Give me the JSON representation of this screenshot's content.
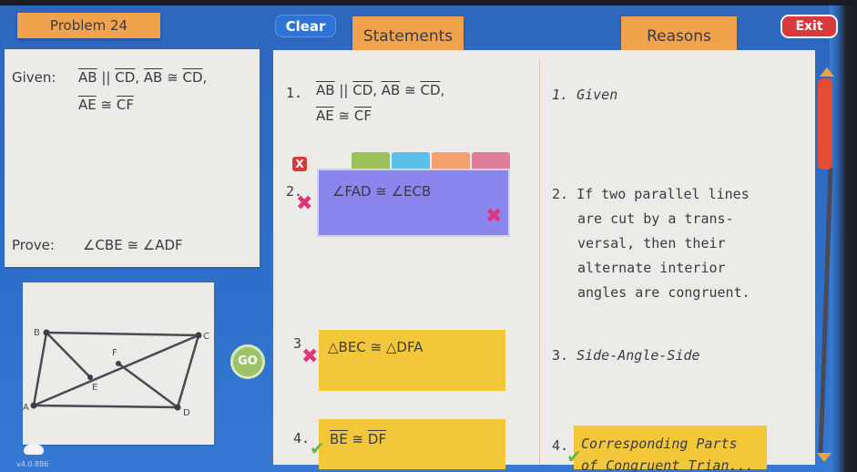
{
  "header": {
    "problem_label": "Problem 24",
    "clear_label": "Clear",
    "statements_label": "Statements",
    "reasons_label": "Reasons",
    "exit_label": "Exit"
  },
  "given": {
    "label": "Given:",
    "line1": {
      "seg1": "AB",
      "parallel": " || ",
      "seg2": "CD",
      "sep": ", ",
      "seg3": "AB",
      "cong": " ≅ ",
      "seg4": "CD",
      "end": ","
    },
    "line2": {
      "seg1": "AE",
      "cong": " ≅ ",
      "seg2": "CF"
    }
  },
  "prove": {
    "label": "Prove:",
    "statement": "∠CBE ≅ ∠ADF"
  },
  "figure": {
    "points": [
      "A",
      "B",
      "C",
      "D",
      "E",
      "F"
    ],
    "segments": [
      "AB",
      "BC",
      "CD",
      "DA",
      "AC",
      "BE",
      "DF"
    ]
  },
  "statements": [
    {
      "number": "1.",
      "line1": {
        "seg1": "AB",
        "parallel": " || ",
        "seg2": "CD",
        "sep": ", ",
        "seg3": "AB",
        "cong": " ≅ ",
        "seg4": "CD",
        "end": ","
      },
      "line2": {
        "seg1": "AE",
        "cong": " ≅ ",
        "seg2": "CF"
      },
      "status": "given"
    },
    {
      "number": "2.",
      "text": "∠FAD ≅ ∠ECB",
      "status": "incorrect",
      "box_color": "#8a86ee"
    },
    {
      "number": "3",
      "text": "△BEC ≅ △DFA",
      "status": "incorrect",
      "box_color": "#f3c73a"
    },
    {
      "number": "4.",
      "seg1": "BE",
      "cong": " ≅ ",
      "seg2": "DF",
      "status": "correct",
      "box_color": "#f3c73a"
    }
  ],
  "reasons": [
    {
      "number": "1.",
      "text": "Given"
    },
    {
      "number": "2.",
      "lines": [
        "If two parallel lines",
        "are cut by a trans-",
        "versal, then their",
        "alternate interior",
        "angles are congruent."
      ]
    },
    {
      "number": "3.",
      "text": "Side-Angle-Side"
    },
    {
      "number": "4.",
      "lines": [
        "Corresponding Parts",
        "of Congruent Trian..."
      ]
    }
  ],
  "color_tabs": [
    "#9cc05a",
    "#5bc0ea",
    "#f5a070",
    "#de7e9c"
  ],
  "icons": {
    "incorrect": "✖",
    "correct": "✔",
    "delete_badge": "X"
  },
  "go_label": "GO",
  "version": "v4.0.886",
  "colors": {
    "tab_orange": "#f0a24c",
    "background_blue": "#2f66bd",
    "exit_red": "#d63a3a",
    "clear_blue": "#2e74d6",
    "scroll_thumb": "#e64c34"
  }
}
